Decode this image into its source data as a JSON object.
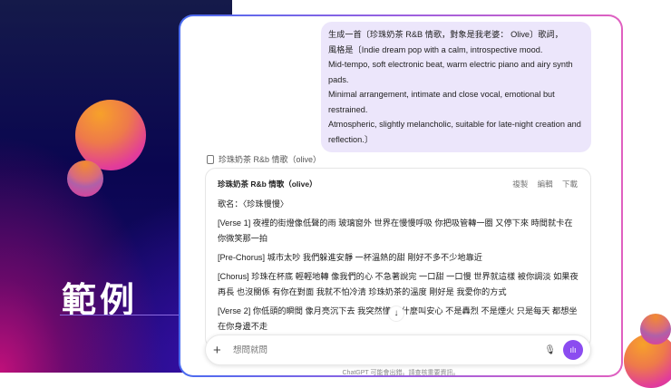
{
  "slide": {
    "title": "範例"
  },
  "chat": {
    "user_message": [
      "生成一首〔珍珠奶茶 R&B 情歌，對象是我老婆： Olive〕歌詞，",
      "風格是〔Indie dream pop with a calm, introspective mood.",
      "Mid-tempo, soft electronic beat, warm electric piano and airy synth pads.",
      "Minimal arrangement, intimate and close vocal, emotional but restrained.",
      "Atmospheric, slightly melancholic, suitable for late-night creation and reflection.〕"
    ],
    "doc_label": "珍珠奶茶 R&b 情歌（olive）",
    "doc": {
      "title": "珍珠奶茶 R&b 情歌（olive）",
      "actions": [
        "複製",
        "編輯",
        "下載"
      ],
      "lines": [
        "歌名：〈珍珠慢慢〉",
        "[Verse 1] 夜裡的街燈像低聲的雨 玻璃窗外 世界在慢慢呼吸 你把吸管轉一圈 又停下來 時間就卡在 你微笑那一拍",
        "[Pre-Chorus] 城市太吵 我們躲進安靜 一杯溫熱的甜 剛好不多不少地靠近",
        "[Chorus] 珍珠在杯底 輕輕地轉 像我們的心 不急著說完 一口甜 一口慢 世界就這樣 被你調淡 如果夜再長 也沒關係 有你在對面 我就不怕冷清 珍珠奶茶的溫度 剛好是 我愛你的方式",
        "[Verse 2] 你低頭的瞬間 像月亮沉下去 我突然懂了 什麼叫安心 不是轟烈 不是煙火 只是每天 都想坐在你身邊不走"
      ]
    },
    "input_placeholder": "想問就問",
    "footer": "ChatGPT 可能會出錯。請查核重要資訊。"
  }
}
